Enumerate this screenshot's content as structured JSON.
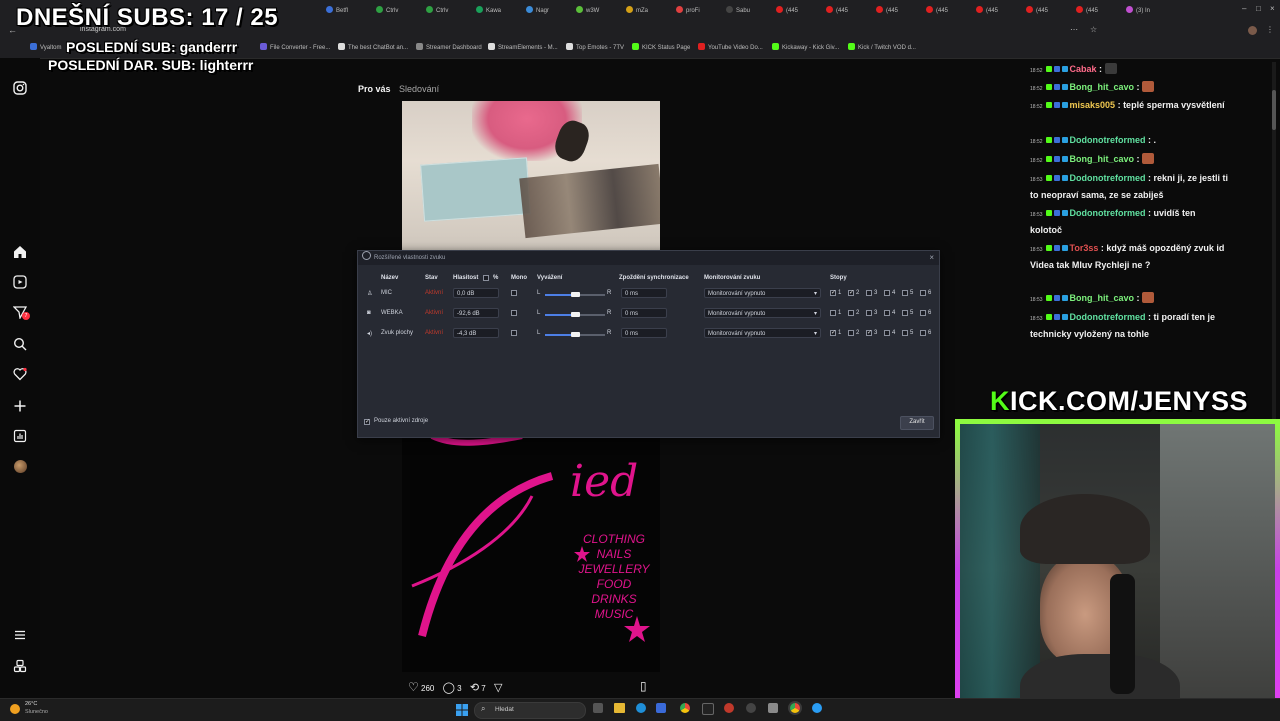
{
  "stream_overlay": {
    "subs_counter": "DNEŠNÍ SUBS: 17 / 25",
    "last_sub": "POSLEDNÍ SUB: ganderrr",
    "last_gift_sub": "POSLEDNÍ DAR. SUB: lighterrr",
    "channel_banner": "KICK.COM/JENYSS"
  },
  "browser": {
    "tabs": [
      "Betfl",
      "Ctrlv",
      "Ctrlv",
      "Kawa",
      "Nagr",
      "w3W",
      "mZa",
      "proFi",
      "Sabu",
      "(445",
      "(445",
      "(445",
      "(445",
      "(445",
      "(445",
      "(445",
      "(3) In"
    ],
    "url": "instagram.com",
    "bookmarks": [
      "Vyaltom",
      "File Converter - Free...",
      "The best ChatBot an...",
      "Streamer Dashboard",
      "StreamElements - M...",
      "Top Emotes - 7TV",
      "KICK Status Page",
      "YouTube Video Do...",
      "Kickaway - Kick Giv...",
      "Kick / Twitch VOD d..."
    ]
  },
  "instagram": {
    "sidebar_icons": [
      "instagram-icon",
      "home-icon",
      "reels-icon",
      "messages-icon",
      "search-icon",
      "notifications-icon",
      "create-icon",
      "dashboard-icon",
      "profile-avatar",
      "menu-icon",
      "threads-icon"
    ],
    "messages_badge": "7",
    "feed_tabs": [
      "Pro vás",
      "Sledování"
    ],
    "post": {
      "poster_words": [
        "CLOTHING",
        "NAILS",
        "JEWELLERY",
        "FOOD",
        "DRINKS",
        "MUSIC"
      ],
      "poster_big": "ied",
      "likes": "260",
      "comments": "3",
      "reposts": "7"
    }
  },
  "obs_dialog": {
    "title": "Rozšířené vlastnosti zvuku",
    "headers": {
      "name": "Název",
      "status": "Stav",
      "volume": "Hlasitost",
      "percent": "%",
      "mono": "Mono",
      "balance": "Vyvážení",
      "sync": "Zpoždění synchronizace",
      "monitoring": "Monitorování zvuku",
      "tracks": "Stopy"
    },
    "rows": [
      {
        "name": "MIC",
        "icon": "mic-icon",
        "status": "Aktivní",
        "volume": "0,0 dB",
        "sync": "0 ms",
        "monitoring": "Monitorování vypnuto",
        "balance": 0.5,
        "tracks": [
          true,
          true,
          false,
          false,
          false,
          false
        ]
      },
      {
        "name": "WEBKA",
        "icon": "camera-icon",
        "status": "Aktivní",
        "volume": "-92,6 dB",
        "sync": "0 ms",
        "monitoring": "Monitorování vypnuto",
        "balance": 0.5,
        "tracks": [
          false,
          false,
          false,
          false,
          false,
          false
        ]
      },
      {
        "name": "Zvuk plochy",
        "icon": "speaker-icon",
        "status": "Aktivní",
        "volume": "-4,3 dB",
        "sync": "0 ms",
        "monitoring": "Monitorování vypnuto",
        "balance": 0.5,
        "tracks": [
          true,
          false,
          true,
          false,
          false,
          false
        ]
      }
    ],
    "balance_left": "L",
    "balance_right": "R",
    "track_numbers": [
      "1",
      "2",
      "3",
      "4",
      "5",
      "6"
    ],
    "active_only_label": "Pouze aktivní zdroje",
    "close_button": "Zavřít"
  },
  "chat": {
    "messages": [
      {
        "time": "18:52",
        "user": "Cabak",
        "color": "#ff6b8a",
        "text": ""
      },
      {
        "time": "18:52",
        "user": "Bong_hit_cavo",
        "color": "#7cf07c",
        "text": ""
      },
      {
        "time": "18:52",
        "user": "misaks005",
        "color": "#f0c850",
        "text": "teplé sperma vysvětlení"
      },
      {
        "time": "18:52",
        "user": "Dodonotreformed",
        "color": "#60e0a0",
        "text": "."
      },
      {
        "time": "18:52",
        "user": "Bong_hit_cavo",
        "color": "#7cf07c",
        "text": ""
      },
      {
        "time": "18:53",
        "user": "Dodonotreformed",
        "color": "#60e0a0",
        "text": "rekni ji, ze jestli ti to neopraví sama, ze se zabiješ"
      },
      {
        "time": "18:53",
        "user": "Dodonotreformed",
        "color": "#60e0a0",
        "text": "uvidíš ten kolotoč"
      },
      {
        "time": "18:53",
        "user": "Tor3ss",
        "color": "#e05050",
        "text": "když máš opozděný zvuk id Videa tak Mluv Rychleji ne ?"
      },
      {
        "time": "18:53",
        "user": "Bong_hit_cavo",
        "color": "#7cf07c",
        "text": ""
      },
      {
        "time": "18:53",
        "user": "Dodonotreformed",
        "color": "#60e0a0",
        "text": "ti poradí ten je technicky vyložený na tohle"
      }
    ]
  },
  "taskbar": {
    "weather_temp": "26°C",
    "weather_desc": "Slunečno",
    "search_placeholder": "Hledat"
  }
}
